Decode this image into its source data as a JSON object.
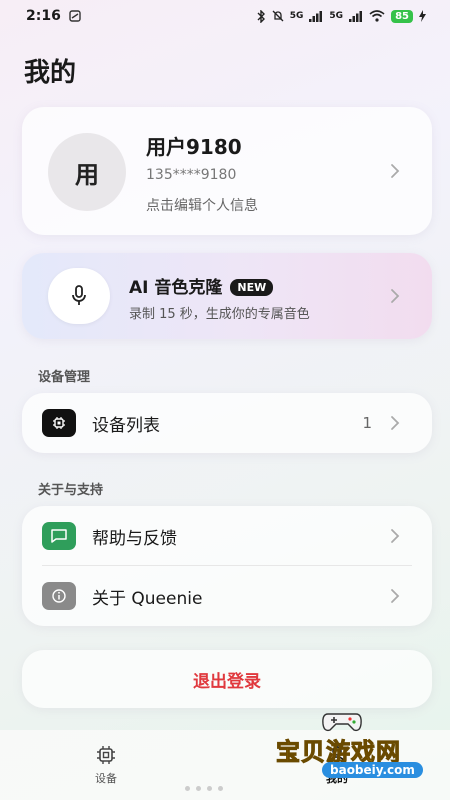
{
  "status": {
    "time": "2:16",
    "battery": "85",
    "signal1": "5G",
    "signal2": "5G"
  },
  "page": {
    "title": "我的"
  },
  "profile": {
    "avatar_char": "用",
    "name": "用户9180",
    "phone": "135****9180",
    "hint": "点击编辑个人信息"
  },
  "ai_card": {
    "title": "AI 音色克隆",
    "badge": "NEW",
    "subtitle": "录制 15 秒，生成你的专属音色"
  },
  "sections": {
    "device": {
      "label": "设备管理",
      "items": [
        {
          "label": "设备列表",
          "count": "1"
        }
      ]
    },
    "support": {
      "label": "关于与支持",
      "items": [
        {
          "label": "帮助与反馈"
        },
        {
          "label": "关于 Queenie"
        }
      ]
    }
  },
  "logout": {
    "label": "退出登录"
  },
  "tabbar": {
    "tabs": [
      {
        "label": "设备"
      },
      {
        "label": "我的"
      }
    ]
  },
  "watermark": {
    "title": "宝贝游戏网",
    "url": "baobeiy.com"
  },
  "colors": {
    "logout_red": "#e0393e",
    "device_icon_bg": "#111111",
    "help_icon_bg": "#2f9e5b",
    "about_icon_bg": "#8a8a8a"
  },
  "icons": [
    "mic-icon",
    "chip-icon",
    "chat-icon",
    "info-icon",
    "chevron-right-icon"
  ]
}
